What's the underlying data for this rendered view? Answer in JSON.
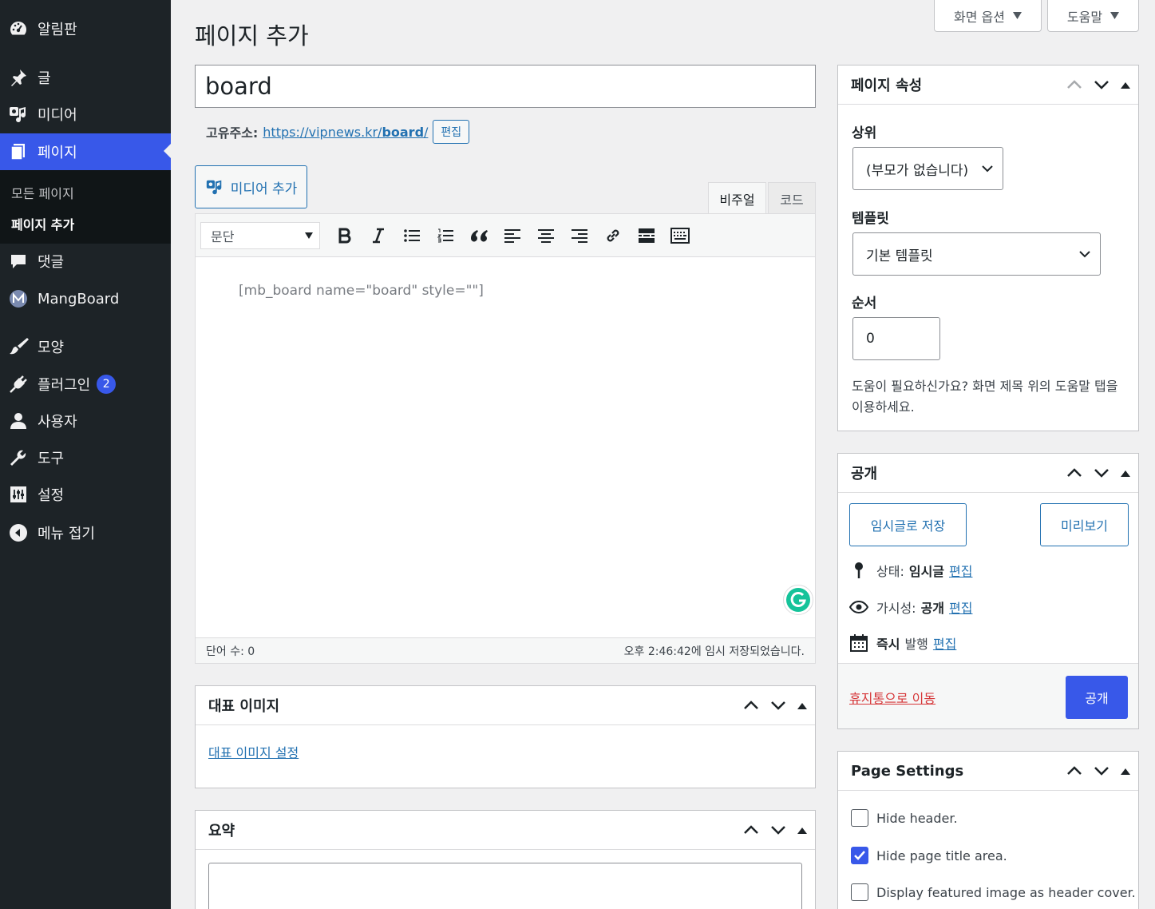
{
  "sidebar": {
    "items": [
      {
        "label": "알림판",
        "icon": "dashboard-icon"
      },
      {
        "label": "글",
        "icon": "pin-icon"
      },
      {
        "label": "미디어",
        "icon": "media-icon"
      },
      {
        "label": "페이지",
        "icon": "pages-icon"
      },
      {
        "label": "댓글",
        "icon": "comments-icon"
      },
      {
        "label": "MangBoard",
        "icon": "mangboard-icon"
      },
      {
        "label": "모양",
        "icon": "appearance-icon"
      },
      {
        "label": "플러그인",
        "icon": "plugins-icon",
        "badge": "2"
      },
      {
        "label": "사용자",
        "icon": "users-icon"
      },
      {
        "label": "도구",
        "icon": "tools-icon"
      },
      {
        "label": "설정",
        "icon": "settings-icon"
      },
      {
        "label": "메뉴 접기",
        "icon": "collapse-icon"
      }
    ],
    "submenu": [
      "모든 페이지",
      "페이지 추가"
    ],
    "accent": "#3858e9"
  },
  "top": {
    "screen_options": "화면 옵션",
    "help": "도움말"
  },
  "page_title": "페이지 추가",
  "post_title": "board",
  "permalink": {
    "label": "고유주소:",
    "url_base": "https://vipnews.kr/",
    "slug": "board",
    "url_end": "/",
    "edit": "편집"
  },
  "editor": {
    "add_media": "미디어 추가",
    "tabs": [
      "비주얼",
      "코드"
    ],
    "format": "문단",
    "content": "[mb_board name=\"board\" style=\"\"]",
    "word_count": "단어 수: 0",
    "autosave": "오후 2:46:42에 임시 저장되었습니다."
  },
  "featured": {
    "title": "대표 이미지",
    "link": "대표 이미지 설정"
  },
  "excerpt": {
    "title": "요약"
  },
  "attributes": {
    "title": "페이지 속성",
    "parent_label": "상위",
    "parent_value": "(부모가 없습니다)",
    "template_label": "템플릿",
    "template_value": "기본 템플릿",
    "order_label": "순서",
    "order_value": "0",
    "help": "도움이 필요하신가요? 화면 제목 위의 도움말 탭을 이용하세요."
  },
  "publish": {
    "title": "공개",
    "save_draft": "임시글로 저장",
    "preview": "미리보기",
    "status_label": "상태:",
    "status_value": "임시글",
    "visibility_label": "가시성:",
    "visibility_value": "공개",
    "schedule_value": "즉시",
    "schedule_label": "발행",
    "edit": "편집",
    "trash": "휴지통으로 이동",
    "publish": "공개"
  },
  "page_settings": {
    "title": "Page Settings",
    "options": [
      {
        "label": "Hide header.",
        "checked": false
      },
      {
        "label": "Hide page title area.",
        "checked": true
      },
      {
        "label": "Display featured image as header cover.",
        "checked": false
      }
    ]
  }
}
